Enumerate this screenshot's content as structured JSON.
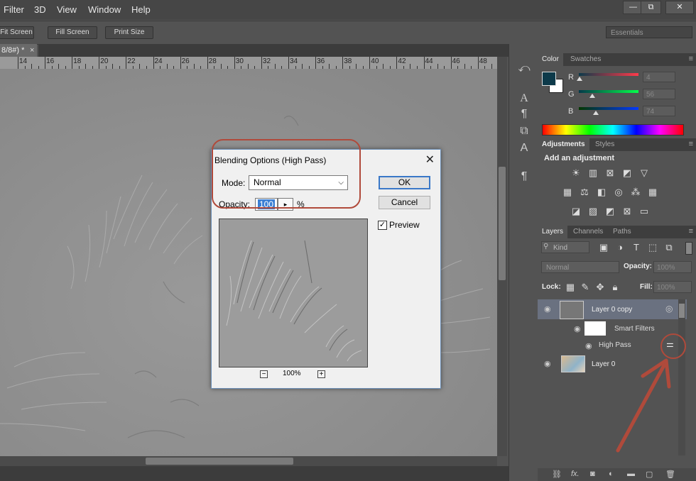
{
  "menu": [
    "Filter",
    "3D",
    "View",
    "Window",
    "Help"
  ],
  "window_controls": {
    "minimize": "—",
    "restore": "⧉",
    "close": "✕"
  },
  "toolbar": {
    "fit_screen": "Fit Screen",
    "fill_screen": "Fill Screen",
    "print_size": "Print Size",
    "workspace": "Essentials"
  },
  "doc_tab": {
    "title": "8/8#) *",
    "close": "×"
  },
  "ruler": {
    "labels": [
      "14",
      "16",
      "18",
      "20",
      "22",
      "24",
      "26",
      "28",
      "30",
      "32",
      "34",
      "36",
      "38",
      "40",
      "42",
      "44",
      "46",
      "48"
    ]
  },
  "color_panel": {
    "tabs": [
      "Color",
      "Swatches"
    ],
    "foreground": "#0d3a4a",
    "channels": [
      {
        "label": "R",
        "value": "4"
      },
      {
        "label": "G",
        "value": "56"
      },
      {
        "label": "B",
        "value": "74"
      }
    ]
  },
  "adjustments_panel": {
    "tabs": [
      "Adjustments",
      "Styles"
    ],
    "heading": "Add an adjustment"
  },
  "layers_panel": {
    "tabs": [
      "Layers",
      "Channels",
      "Paths"
    ],
    "filter_kind": "Kind",
    "blend_mode": "Normal",
    "opacity_label": "Opacity:",
    "opacity_value": "100%",
    "lock_label": "Lock:",
    "fill_label": "Fill:",
    "fill_value": "100%",
    "layers": [
      {
        "name": "Layer 0 copy",
        "selected": true
      },
      {
        "name": "Smart Filters"
      },
      {
        "name": "High Pass"
      },
      {
        "name": "Layer 0"
      }
    ],
    "footer_fx": "fx."
  },
  "dialog": {
    "title": "Blending Options (High Pass)",
    "close": "✕",
    "mode_label": "Mode:",
    "mode_value": "Normal",
    "opacity_label": "Opacity:",
    "opacity_value": "100",
    "opacity_unit": "%",
    "ok": "OK",
    "cancel": "Cancel",
    "preview_label": "Preview",
    "preview_checked": true,
    "zoom": "100%",
    "zoom_out": "−",
    "zoom_in": "+"
  },
  "accent_colors": {
    "annotation": "#b04a3b",
    "selection": "#3b7fd4"
  }
}
